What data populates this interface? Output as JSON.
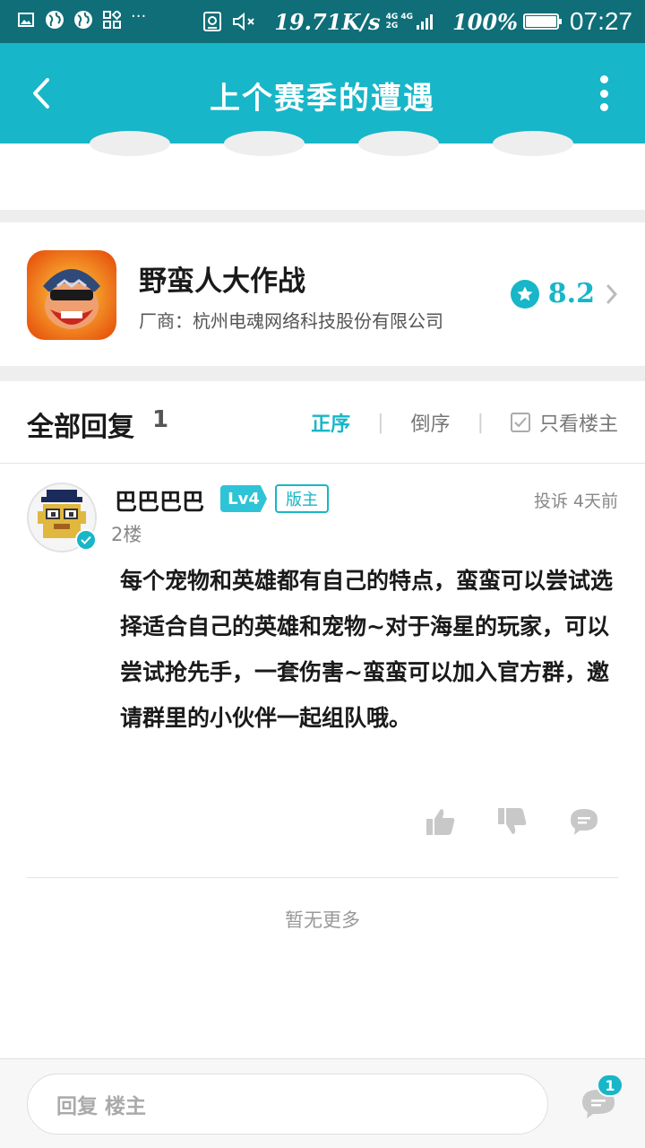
{
  "status_bar": {
    "net_speed": "19.71K/s",
    "network_top": "4G 4G",
    "network_bottom": "2G",
    "battery_percent": "100%",
    "battery_level": 1.0,
    "time": "07:27",
    "overflow": "···",
    "icons": [
      "gallery-icon",
      "globe-icon",
      "globe-icon",
      "app-grid-icon",
      "nfc-icon",
      "mute-icon",
      "signal-icon",
      "battery-icon"
    ]
  },
  "header": {
    "title": "上个赛季的遭遇",
    "back_icon": "chevron-left-icon",
    "menu_icon": "more-vertical-icon"
  },
  "game": {
    "name": "野蛮人大作战",
    "vendor": "厂商：杭州电魂网络科技股份有限公司",
    "rating": "8.2",
    "rating_icon": "star-icon"
  },
  "replies": {
    "title": "全部回复",
    "count": "1",
    "sort_asc": "正序",
    "sort_desc": "倒序",
    "only_op": "只看楼主",
    "separator": "|"
  },
  "post": {
    "username": "巴巴巴巴",
    "level": "Lv4",
    "role": "版主",
    "floor": "2楼",
    "report": "投诉",
    "time_ago": "4天前",
    "body": "每个宠物和英雄都有自己的特点，蛮蛮可以尝试选择适合自己的英雄和宠物~对于海星的玩家，可以尝试抢先手，一套伤害~蛮蛮可以加入官方群，邀请群里的小伙伴一起组队哦。"
  },
  "footer_note": "暂无更多",
  "bottom_bar": {
    "placeholder": "回复 楼主",
    "comments_badge": "1"
  },
  "colors": {
    "accent": "#17b6c8",
    "status_bar": "#0f6e78",
    "divider": "#eeeeee"
  }
}
